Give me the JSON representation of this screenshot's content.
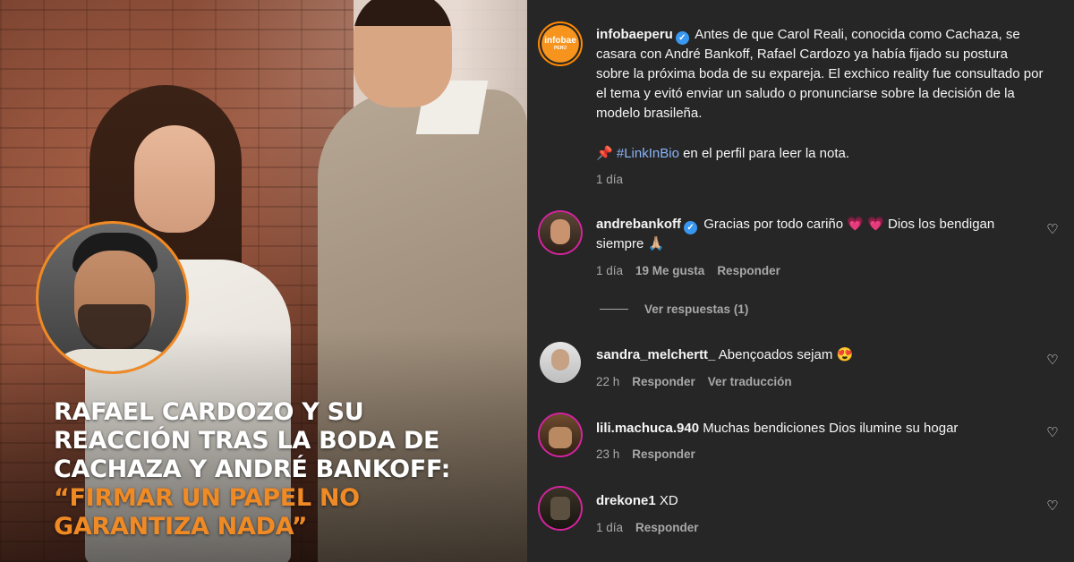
{
  "headline": {
    "line1": "Rafael Cardozo y su",
    "line2": "reacción tras la boda de",
    "line3": "Cachaza y André Bankoff:",
    "line4": "“Firmar un papel no",
    "line5": "garantiza nada”"
  },
  "post": {
    "avatar_logo_main": "infobae",
    "avatar_logo_sub": "PERÚ",
    "username": "infobaeperu",
    "caption": "Antes de que Carol Reali, conocida como Cachaza, se casara con André Bankoff, Rafael Cardozo ya había fijado su postura sobre la próxima boda de su expareja. El exchico reality fue consultado por el tema y evitó enviar un saludo o pronunciarse sobre la decisión de la modelo brasileña.",
    "hashtag": "#LinkInBio",
    "hashtag_suffix": "en el perfil para leer la nota.",
    "time": "1 día"
  },
  "comments": [
    {
      "username": "andrebankoff",
      "verified": true,
      "text_before": "Gracias por todo cariño",
      "text_after": "Dios los bendigan siempre",
      "time": "1 día",
      "likes": "19 Me gusta",
      "reply": "Responder",
      "view_replies": "Ver respuestas (1)"
    },
    {
      "username": "sandra_melchertt_",
      "text": "Abençoados sejam",
      "time": "22 h",
      "reply": "Responder",
      "translate": "Ver traducción"
    },
    {
      "username": "lili.machuca.940",
      "text": "Muchas bendiciones Dios ilumine su hogar",
      "time": "23 h",
      "reply": "Responder"
    },
    {
      "username": "drekone1",
      "text": "XD",
      "time": "1 día",
      "reply": "Responder"
    }
  ],
  "icons": {
    "verified": "verified-badge-icon",
    "like": "heart-outline-icon",
    "pin": "pushpin-icon"
  },
  "colors": {
    "accent_orange": "#f08a24",
    "panel_bg": "#262626",
    "link_blue": "#8ab4f8",
    "verified_blue": "#3897f0"
  }
}
